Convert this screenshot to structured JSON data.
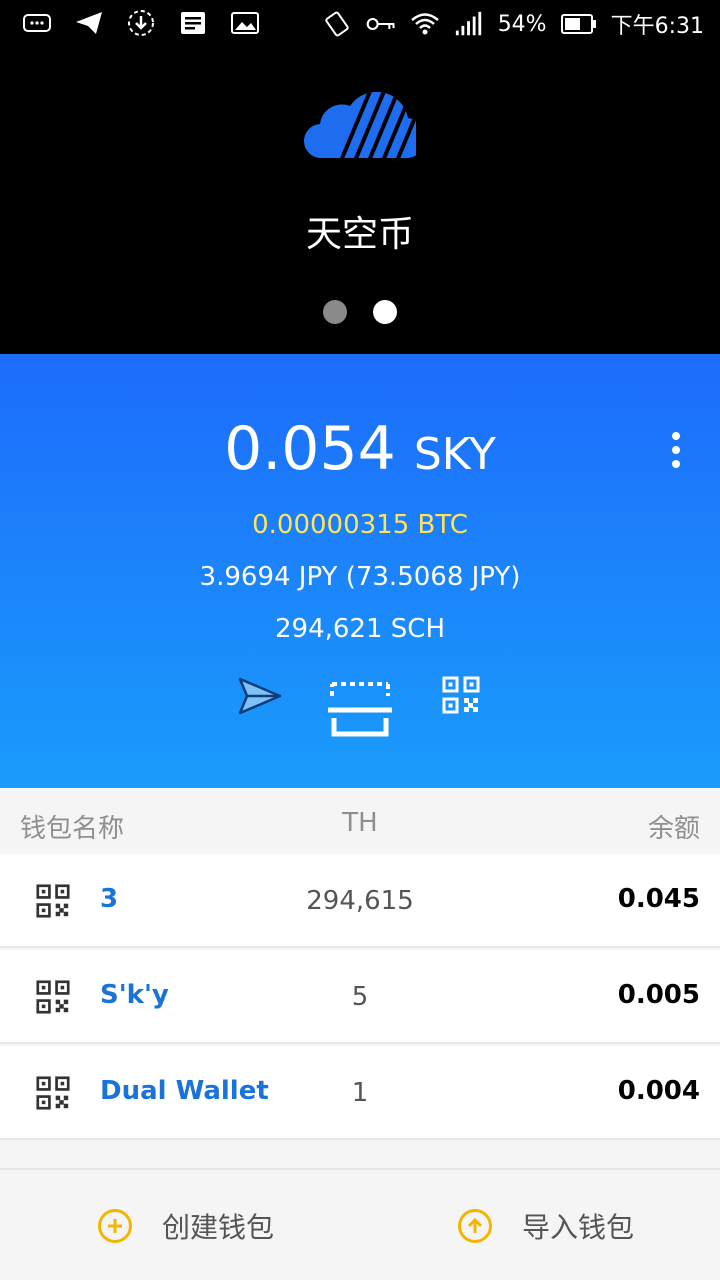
{
  "status_bar": {
    "battery_percent": "54%",
    "time": "下午6:31"
  },
  "header": {
    "app_name": "天空币",
    "page_index": 2,
    "page_count": 2
  },
  "balance": {
    "amount": "0.054",
    "unit": "SKY",
    "btc": "0.00000315 BTC",
    "jpy": "3.9694 JPY (73.5068 JPY)",
    "sch": "294,621 SCH"
  },
  "table": {
    "columns": [
      "钱包名称",
      "TH",
      "余额"
    ],
    "rows": [
      {
        "name": "3",
        "th": "294,615",
        "balance": "0.045"
      },
      {
        "name": "S'k'y",
        "th": "5",
        "balance": "0.005"
      },
      {
        "name": "Dual Wallet",
        "th": "1",
        "balance": "0.004"
      }
    ]
  },
  "bottom": {
    "create_label": "创建钱包",
    "import_label": "导入钱包"
  },
  "colors": {
    "accent_blue": "#1d6cfb",
    "yellow": "#ffe35a",
    "link_blue": "#1a73d9",
    "orange": "#f5b400"
  }
}
